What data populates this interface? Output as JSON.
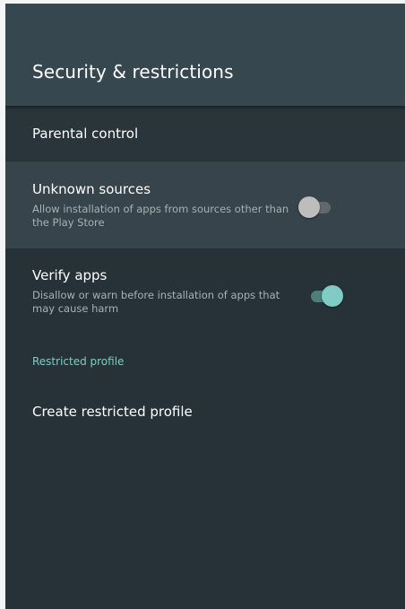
{
  "header": {
    "title": "Security & restrictions"
  },
  "items": {
    "parental_control": {
      "title": "Parental control"
    },
    "unknown_sources": {
      "title": "Unknown sources",
      "summary": "Allow installation of apps from sources other than the Play Store",
      "switch_on": false
    },
    "verify_apps": {
      "title": "Verify apps",
      "summary": "Disallow or warn before installation of apps that may cause harm",
      "switch_on": true
    }
  },
  "restricted_profile": {
    "category_label": "Restricted profile",
    "create_label": "Create restricted profile"
  },
  "colors": {
    "background": "#263238",
    "header": "#37474f",
    "accent": "#80cbc4",
    "focused_row": "#37444b"
  }
}
